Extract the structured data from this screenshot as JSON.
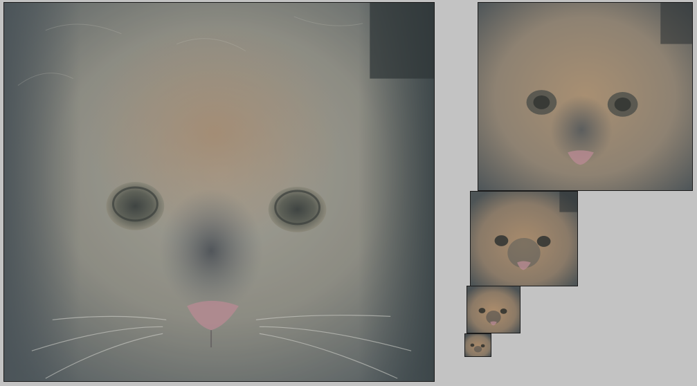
{
  "scene": "hybrid-image-pyramid",
  "colors": {
    "background": "#c3c3c3",
    "border": "#1a1a1a",
    "fur_light": "#a9a597",
    "fur_warm": "#a08a70",
    "shadow": "#3c4448",
    "nose": "#b48a92"
  },
  "panels": [
    {
      "name": "hybrid-panel-full",
      "subject": "cat-face"
    },
    {
      "name": "hybrid-panel-half",
      "subject": "dog-face"
    },
    {
      "name": "hybrid-panel-quarter",
      "subject": "dog-face"
    },
    {
      "name": "hybrid-panel-eighth",
      "subject": "dog-face"
    },
    {
      "name": "hybrid-panel-sixteenth",
      "subject": "dog-face"
    }
  ]
}
